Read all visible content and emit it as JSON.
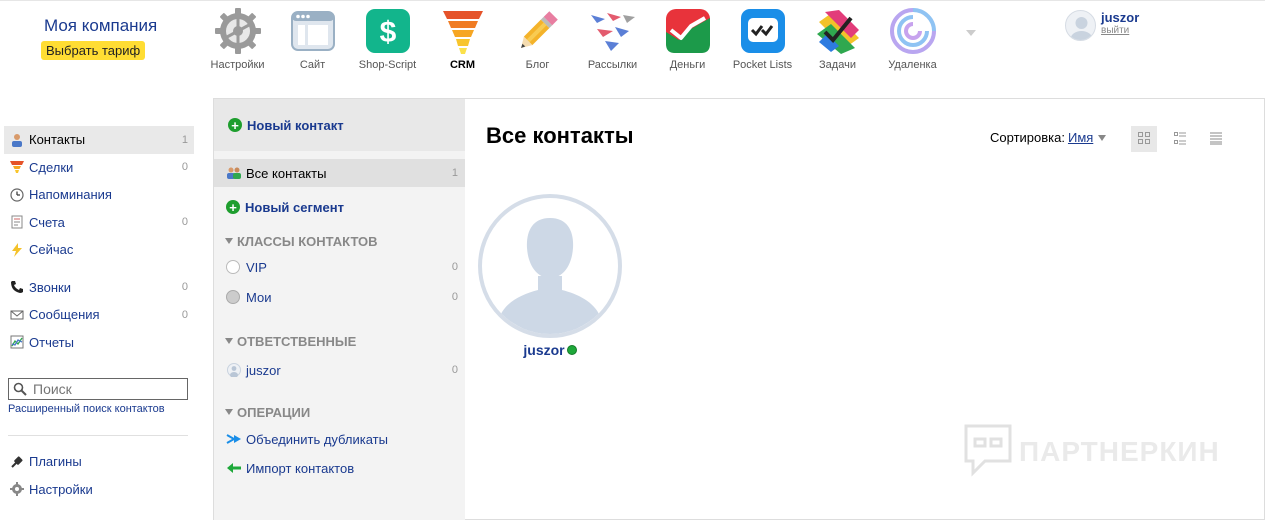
{
  "header": {
    "company": "Моя компания",
    "plan_button": "Выбрать тариф",
    "apps": [
      {
        "label": "Настройки",
        "icon": "settings-gear-icon"
      },
      {
        "label": "Сайт",
        "icon": "site-icon"
      },
      {
        "label": "Shop-Script",
        "icon": "shop-script-icon"
      },
      {
        "label": "CRM",
        "icon": "crm-funnel-icon"
      },
      {
        "label": "Блог",
        "icon": "blog-pencil-icon"
      },
      {
        "label": "Рассылки",
        "icon": "mailer-planes-icon"
      },
      {
        "label": "Деньги",
        "icon": "money-chart-icon"
      },
      {
        "label": "Pocket Lists",
        "icon": "pocket-lists-icon"
      },
      {
        "label": "Задачи",
        "icon": "tasks-icon"
      },
      {
        "label": "Удаленка",
        "icon": "remote-spiral-icon"
      }
    ],
    "user": {
      "name": "juszor",
      "exit": "выйти"
    }
  },
  "sidebar": {
    "items": [
      {
        "label": "Контакты",
        "count": "1",
        "icon": "contacts-icon"
      },
      {
        "label": "Сделки",
        "count": "0",
        "icon": "deals-funnel-icon"
      },
      {
        "label": "Напоминания",
        "count": "",
        "icon": "clock-icon"
      },
      {
        "label": "Счета",
        "count": "0",
        "icon": "invoice-icon"
      },
      {
        "label": "Сейчас",
        "count": "",
        "icon": "lightning-icon"
      },
      {
        "label": "Звонки",
        "count": "0",
        "icon": "phone-icon"
      },
      {
        "label": "Сообщения",
        "count": "0",
        "icon": "envelope-icon"
      },
      {
        "label": "Отчеты",
        "count": "",
        "icon": "report-chart-icon"
      }
    ],
    "search_placeholder": "Поиск",
    "advanced_search": "Расширенный поиск контактов",
    "bottom_items": [
      {
        "label": "Плагины",
        "icon": "plug-icon"
      },
      {
        "label": "Настройки",
        "icon": "gear-icon"
      }
    ]
  },
  "middle": {
    "new_contact": "Новый контакт",
    "all_contacts": "Все контакты",
    "all_contacts_count": "1",
    "new_segment": "Новый сегмент",
    "classes_header": "КЛАССЫ КОНТАКТОВ",
    "classes": [
      {
        "label": "VIP",
        "count": "0"
      },
      {
        "label": "Мои",
        "count": "0"
      }
    ],
    "responsible_header": "ОТВЕТСТВЕННЫЕ",
    "responsible": [
      {
        "label": "juszor",
        "count": "0"
      }
    ],
    "operations_header": "ОПЕРАЦИИ",
    "operations": [
      {
        "label": "Объединить дубликаты",
        "icon": "merge-arrows-icon"
      },
      {
        "label": "Импорт контактов",
        "icon": "import-arrow-icon"
      }
    ]
  },
  "main": {
    "title": "Все контакты",
    "sort_label": "Сортировка:",
    "sort_value": "Имя",
    "contact_name": "juszor",
    "watermark": "ПАРТНЕРКИН"
  },
  "colors": {
    "link": "#1a3a8f",
    "plan_button": "#ffdd33",
    "online": "#1ea83a"
  }
}
